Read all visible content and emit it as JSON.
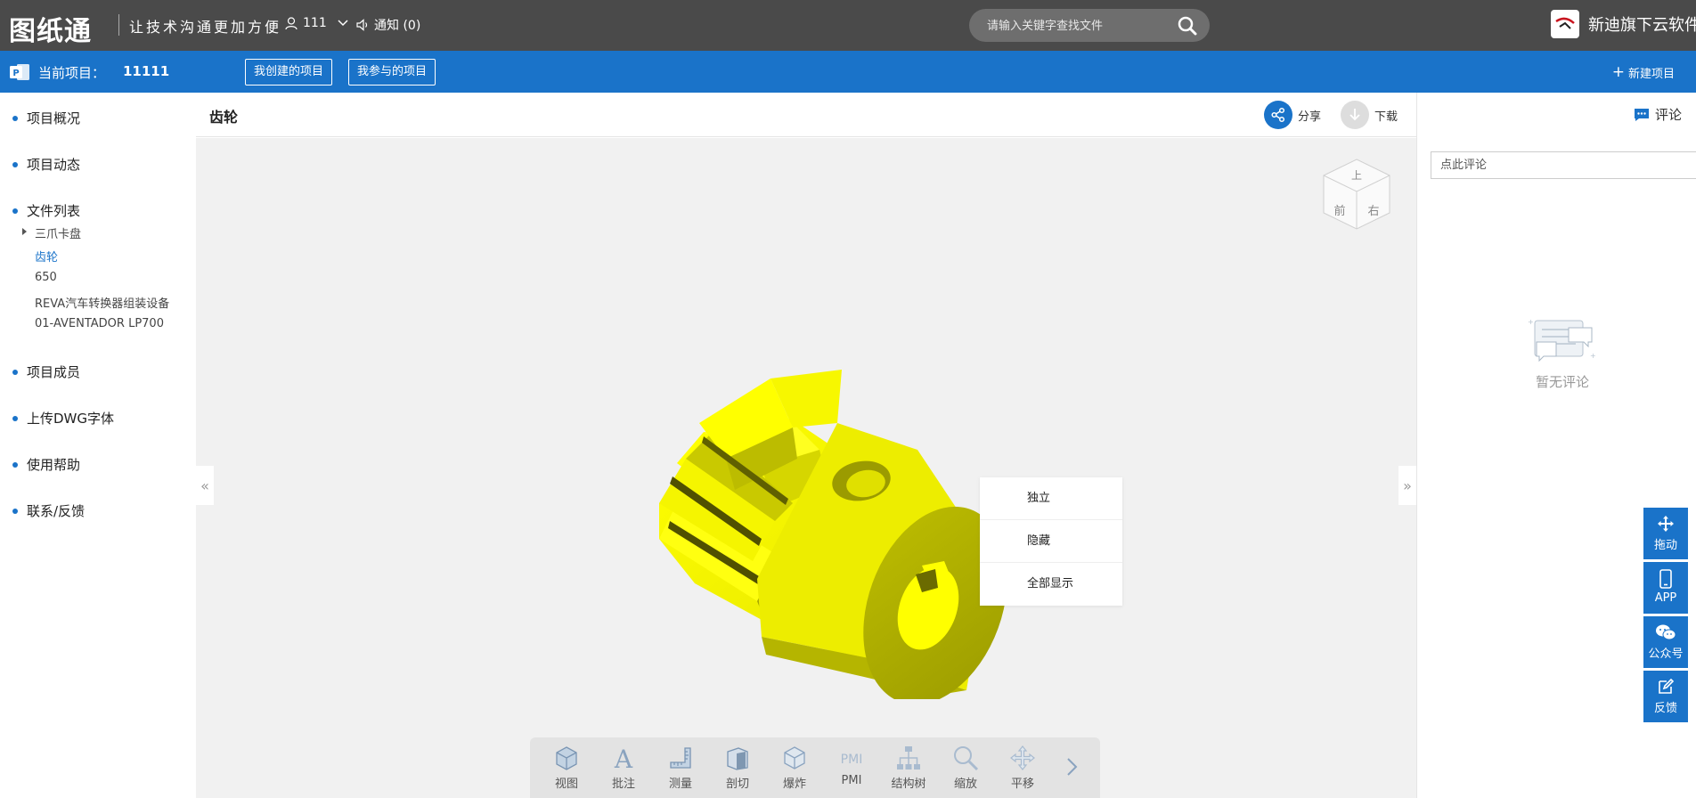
{
  "topbar": {
    "logo": "图纸通",
    "slogan": "让技术沟通更加方便",
    "user": "111",
    "notice": "通知 (0)",
    "search_placeholder": "请输入关键字查找文件",
    "brand": "新迪旗下云软件"
  },
  "bluebar": {
    "current_label": "当前项目：",
    "current_name": "11111",
    "my_created": "我创建的项目",
    "my_joined": "我参与的项目",
    "new_project": "新建项目"
  },
  "sidebar": {
    "overview": "项目概况",
    "activity": "项目动态",
    "filelist": "文件列表",
    "files": [
      "三爪卡盘",
      "齿轮",
      "650",
      "REVA汽车转换器组装设备",
      "01-AVENTADOR LP700"
    ],
    "members": "项目成员",
    "upload_font": "上传DWG字体",
    "help": "使用帮助",
    "feedback": "联系/反馈"
  },
  "viewer": {
    "title": "齿轮",
    "share": "分享",
    "download": "下载",
    "viewcube": {
      "top": "上",
      "front": "前",
      "right": "右"
    },
    "context_menu": [
      "独立",
      "隐藏",
      "全部显示"
    ],
    "tools": [
      "视图",
      "批注",
      "测量",
      "剖切",
      "爆炸",
      "PMI",
      "结构树",
      "缩放",
      "平移"
    ],
    "pmi_icon_text": "PMI"
  },
  "rpanel": {
    "tab": "评论",
    "input_placeholder": "点此评论",
    "empty": "暂无评论"
  },
  "floatbar": [
    "拖动",
    "APP",
    "公众号",
    "反馈"
  ],
  "colors": {
    "topbar": "#4a4a4a",
    "accent": "#1a73c9",
    "model": "#ffff00"
  }
}
